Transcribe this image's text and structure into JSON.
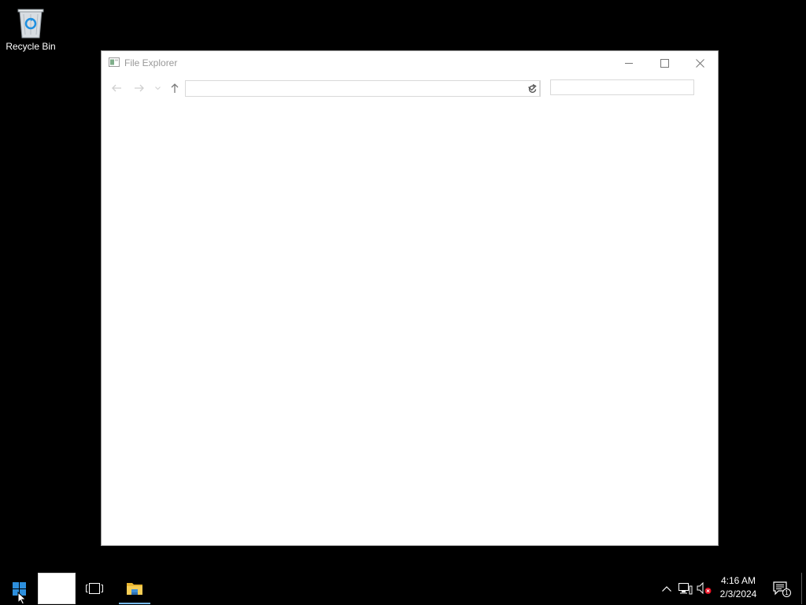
{
  "desktop": {
    "recycle_bin_label": "Recycle Bin"
  },
  "window": {
    "title": "File Explorer",
    "address_value": "",
    "search_placeholder": "",
    "controls": {
      "minimize_icon": "minimize-icon",
      "maximize_icon": "maximize-icon",
      "close_icon": "close-icon"
    },
    "nav": {
      "back_icon": "arrow-left-icon",
      "forward_icon": "arrow-right-icon",
      "recent_icon": "chevron-down-icon",
      "up_icon": "arrow-up-icon",
      "refresh_icon": "refresh-icon"
    }
  },
  "taskbar": {
    "start_icon": "windows-logo-icon",
    "search_icon": "search-icon",
    "taskview_icon": "task-view-icon",
    "pinned_apps": [
      {
        "name": "File Explorer",
        "icon": "folder-icon",
        "active": true
      }
    ],
    "tray": {
      "chevron_icon": "chevron-up-icon",
      "network_icon": "network-icon",
      "volume_icon": "volume-muted-icon",
      "time": "4:16 AM",
      "date": "2/3/2024",
      "notifications_count": "1"
    }
  },
  "colors": {
    "desktop_bg": "#000000",
    "window_bg": "#ffffff",
    "accent": "#0078d7",
    "active_underline": "#76b9ed"
  }
}
